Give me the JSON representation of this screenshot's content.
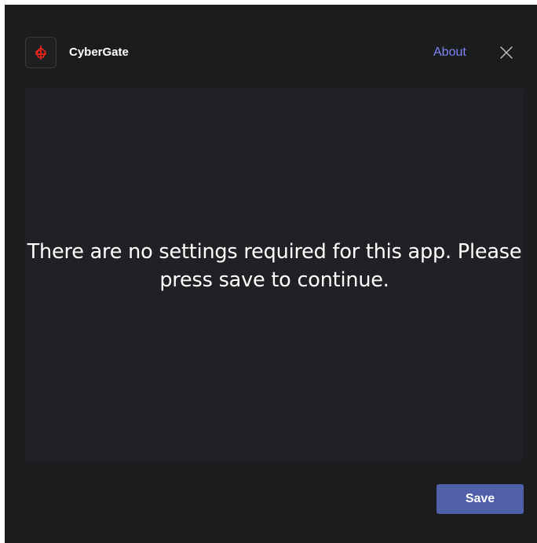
{
  "header": {
    "app_name": "CyberGate",
    "about_label": "About",
    "logo_icon": "cybergate-logo-icon",
    "close_icon": "close-icon"
  },
  "content": {
    "message": "There are no settings required for this app. Please press save to continue."
  },
  "footer": {
    "save_label": "Save"
  },
  "colors": {
    "background": "#1b1c1e",
    "panel": "#202124",
    "accent_link": "#7f85f5",
    "primary_button": "#4f5fa9",
    "logo_red": "#e8251d"
  }
}
